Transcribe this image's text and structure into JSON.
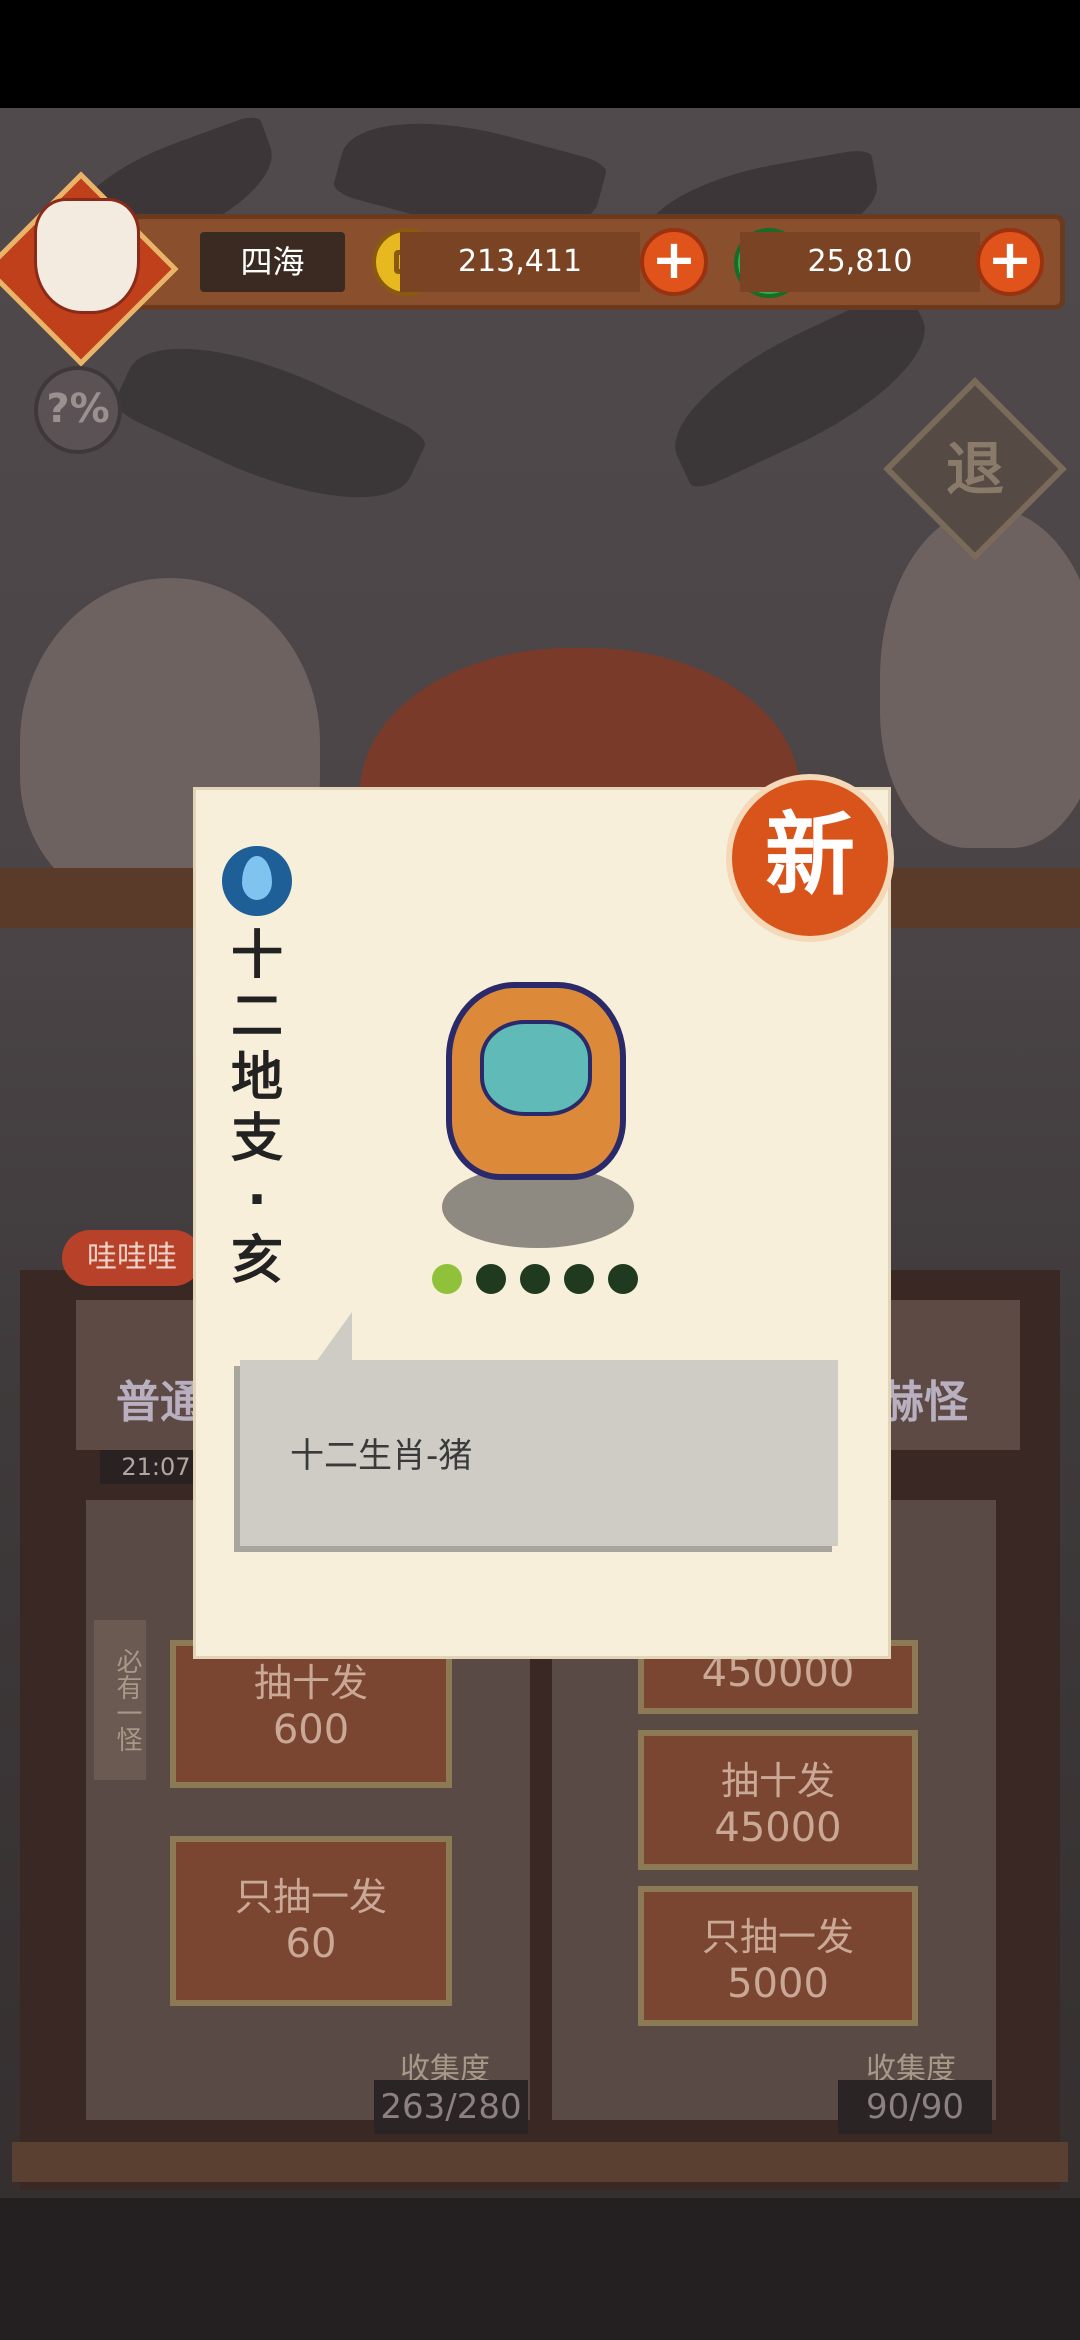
{
  "header": {
    "player_name": "四海",
    "coins": "213,411",
    "jade": "25,810",
    "exit_label": "退",
    "help_label": "?%"
  },
  "background": {
    "tag_label": "哇哇哇",
    "left_banner": "普通",
    "timer": "21:07:",
    "right_banner": "赫怪",
    "side_label": "必有一怪",
    "left_buttons": [
      {
        "label": "抽十发",
        "cost": "600"
      },
      {
        "label": "只抽一发",
        "cost": "60"
      }
    ],
    "right_buttons": [
      {
        "label": "",
        "cost": "450000"
      },
      {
        "label": "抽十发",
        "cost": "45000"
      },
      {
        "label": "只抽一发",
        "cost": "5000"
      }
    ],
    "left_collect_label": "收集度",
    "left_collect_value": "263/280",
    "right_collect_label": "收集度",
    "right_collect_value": "90/90"
  },
  "card": {
    "new_badge": "新",
    "title_chars": [
      "十",
      "二",
      "地",
      "支",
      "·",
      "亥"
    ],
    "stars_filled": 1,
    "stars_total": 5,
    "description": "十二生肖-猪",
    "element_icon": "water-drop-icon"
  }
}
